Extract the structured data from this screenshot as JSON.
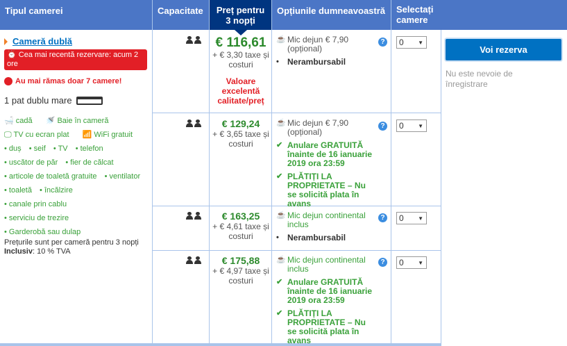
{
  "header": {
    "room_type": "Tipul camerei",
    "capacity": "Capacitate",
    "price": "Preț pentru 3 nopți",
    "options": "Opțiunile dumneavoastră",
    "select": "Selectați camere"
  },
  "room": {
    "name": "Cameră dublă",
    "recent_booking": "Cea mai recentă rezervare: acum 2 ore",
    "rooms_left": "Au mai rămas doar 7 camere!",
    "bed": "1 pat dublu mare",
    "features": [
      "cadă",
      "Baie în cameră",
      "TV cu ecran plat",
      "WiFi gratuit"
    ],
    "facilities": [
      "duș",
      "seif",
      "TV",
      "telefon",
      "uscător de păr",
      "fier de călcat",
      "articole de toaletă gratuite",
      "ventilator",
      "toaletă",
      "încălzire",
      "canale prin cablu",
      "serviciu de trezire",
      "Garderobă sau dulap"
    ],
    "note_line1": "Prețurile sunt per cameră pentru 3 nopți",
    "note_included_label": "Inclusiv",
    "note_included_value": ": 10 % TVA"
  },
  "rows": [
    {
      "price": "€ 116,61",
      "tax": "+ € 3,30 taxe și costuri",
      "badge": "Valoare excelentă calitate/preț",
      "meal": "Mic dejun € 7,90",
      "meal_note": "(opțional)",
      "policy": "Nerambursabil",
      "select": "0"
    },
    {
      "price": "€ 129,24",
      "tax": "+ € 3,65 taxe și costuri",
      "meal": "Mic dejun € 7,90",
      "meal_note": "(opțional)",
      "cancel": "Anulare GRATUITĂ înainte de 16 ianuarie 2019 ora 23:59",
      "pay": "PLĂTIȚI LA PROPRIETATE – Nu se solicită plata în avans",
      "select": "0"
    },
    {
      "price": "€ 163,25",
      "tax": "+ € 4,61 taxe și costuri",
      "meal": "Mic dejun continental inclus",
      "policy": "Nerambursabil",
      "select": "0"
    },
    {
      "price": "€ 175,88",
      "tax": "+ € 4,97 taxe și costuri",
      "meal": "Mic dejun continental inclus",
      "cancel": "Anulare GRATUITĂ înainte de 16 ianuarie 2019 ora 23:59",
      "pay": "PLĂTIȚI LA PROPRIETATE – Nu se solicită plata în avans",
      "select": "0"
    }
  ],
  "panel": {
    "book_button": "Voi rezerva",
    "no_registration": "Nu este nevoie de înregistrare"
  },
  "colors": {
    "header": "#4b76c6",
    "price_header": "#003580",
    "green": "#3aa13a",
    "red": "#e21f26",
    "link": "#0071c2"
  }
}
